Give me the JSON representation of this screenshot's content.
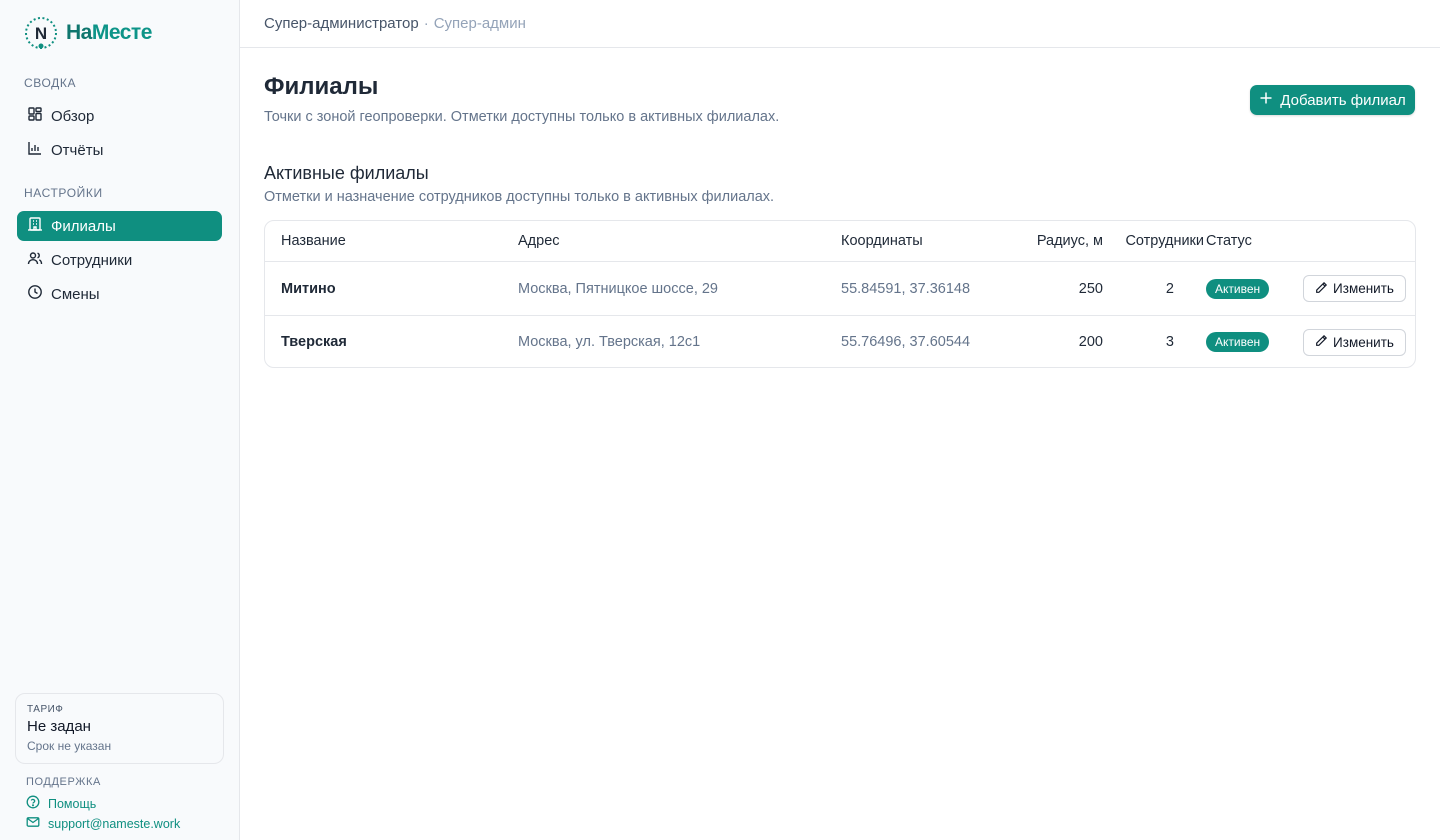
{
  "brand": {
    "mark": "N",
    "name_part1": "На",
    "name_part2": "Месте",
    "color": "#0f8f80"
  },
  "sidebar": {
    "section_summary": "СВОДКА",
    "summary_items": [
      {
        "label": "Обзор",
        "icon": "dashboard-icon"
      },
      {
        "label": "Отчёты",
        "icon": "bar-chart-icon"
      }
    ],
    "section_settings": "НАСТРОЙКИ",
    "settings_items": [
      {
        "label": "Филиалы",
        "icon": "building-icon",
        "active": true
      },
      {
        "label": "Сотрудники",
        "icon": "users-icon"
      },
      {
        "label": "Смены",
        "icon": "clock-icon"
      }
    ],
    "tariff": {
      "label": "ТАРИФ",
      "value": "Не задан",
      "sub": "Срок не указан"
    },
    "support": {
      "label": "ПОДДЕРЖКА",
      "help": "Помощь",
      "email": "support@nameste.work"
    }
  },
  "header": {
    "role": "Супер-администратор",
    "separator": "·",
    "sub": "Супер-админ"
  },
  "main": {
    "title": "Филиалы",
    "subtitle": "Точки с зоной геопроверки. Отметки доступны только в активных филиалах.",
    "add_button": "Добавить филиал",
    "section_title": "Активные филиалы",
    "section_subtitle": "Отметки и назначение сотрудников доступны только в активных филиалах.",
    "table": {
      "columns": [
        "Название",
        "Адрес",
        "Координаты",
        "Радиус, м",
        "Сотрудники",
        "Статус"
      ],
      "rows": [
        {
          "name": "Митино",
          "address": "Москва, Пятницкое шоссе, 29",
          "coords": "55.84591, 37.36148",
          "radius": "250",
          "employees": "2",
          "status": "Активен",
          "action": "Изменить"
        },
        {
          "name": "Тверская",
          "address": "Москва, ул. Тверская, 12с1",
          "coords": "55.76496, 37.60544",
          "radius": "200",
          "employees": "3",
          "status": "Активен",
          "action": "Изменить"
        }
      ]
    }
  }
}
